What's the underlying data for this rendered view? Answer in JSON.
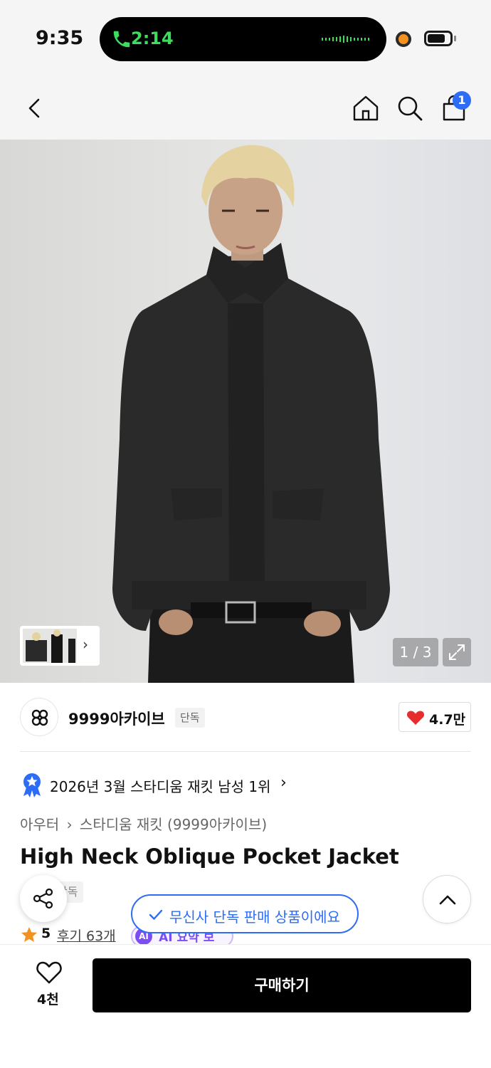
{
  "status_bar": {
    "time": "9:35",
    "call_time": "2:14"
  },
  "nav": {
    "cart_count": "1"
  },
  "gallery": {
    "counter": "1 / 3"
  },
  "brand": {
    "name": "9999아카이브",
    "exclusive_tag": "단독",
    "like_count": "4.7만"
  },
  "ranking": {
    "text": "2026년 3월 스타디움 재킷 남성 1위",
    "chevron": "›"
  },
  "breadcrumb": {
    "category": "아우터",
    "separator": "›",
    "subcategory": "스타디움 재킷 (9999아카이브)"
  },
  "product": {
    "title": "High Neck Oblique Pocket Jacket",
    "tag": "단독"
  },
  "toast": {
    "text": "무신사 단독 판매 상품이에요"
  },
  "rating": {
    "score": "5",
    "reviews": "후기 63개",
    "ai_chip": "AI",
    "ai_label": "AI 요약 보기"
  },
  "bottom_bar": {
    "wish_count": "4천",
    "buy_label": "구매하기"
  },
  "colors": {
    "accent_blue": "#2c6cf6",
    "heart_red": "#e62c2c",
    "call_green": "#3ddc5f",
    "ai_purple": "#7b4df2",
    "star_orange": "#f39221"
  }
}
